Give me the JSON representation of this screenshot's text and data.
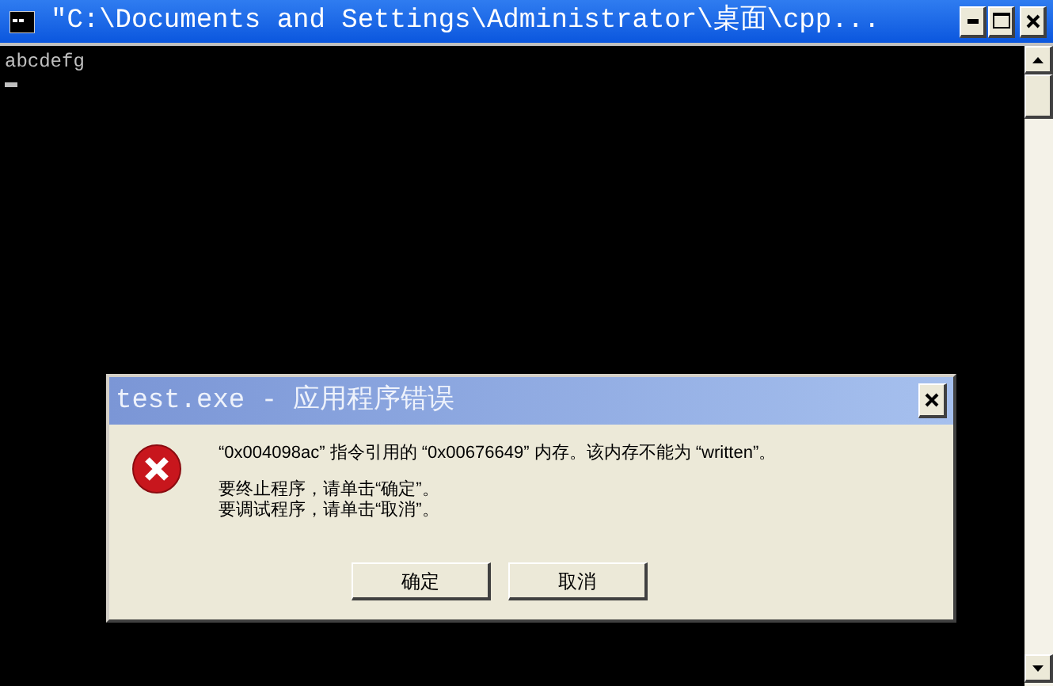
{
  "window": {
    "title": "\"C:\\Documents and Settings\\Administrator\\桌面\\cpp..."
  },
  "console": {
    "lines": [
      "abcdefg"
    ]
  },
  "dialog": {
    "title": "test.exe - 应用程序错误",
    "message": "“0x004098ac” 指令引用的 “0x00676649” 内存。该内存不能为 “written”。",
    "hints": [
      "要终止程序，请单击“确定”。",
      "要调试程序，请单击“取消”。"
    ],
    "buttons": [
      "确定",
      "取消"
    ]
  }
}
